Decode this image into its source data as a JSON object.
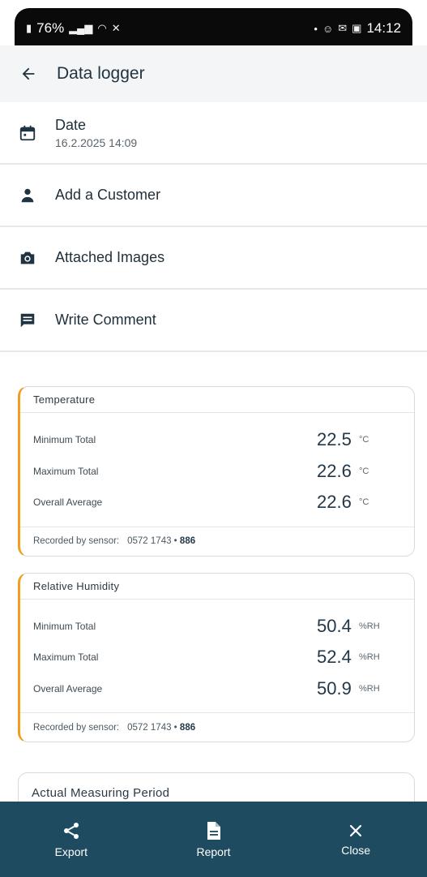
{
  "status_bar": {
    "battery": "76%",
    "time": "14:12"
  },
  "app_bar": {
    "title": "Data logger"
  },
  "menu": {
    "date_label": "Date",
    "date_value": "16.2.2025 14:09",
    "customer_label": "Add a Customer",
    "images_label": "Attached Images",
    "comment_label": "Write Comment"
  },
  "temperature": {
    "title": "Temperature",
    "rows": [
      {
        "label": "Minimum Total",
        "value": "22.5",
        "unit": "°C"
      },
      {
        "label": "Maximum Total",
        "value": "22.6",
        "unit": "°C"
      },
      {
        "label": "Overall Average",
        "value": "22.6",
        "unit": "°C"
      }
    ],
    "sensor_label": "Recorded by sensor:",
    "sensor_id": "0572 1743 •",
    "sensor_suffix": "886"
  },
  "humidity": {
    "title": "Relative Humidity",
    "rows": [
      {
        "label": "Minimum Total",
        "value": "50.4",
        "unit": "%RH"
      },
      {
        "label": "Maximum Total",
        "value": "52.4",
        "unit": "%RH"
      },
      {
        "label": "Overall Average",
        "value": "50.9",
        "unit": "%RH"
      }
    ],
    "sensor_label": "Recorded by sensor:",
    "sensor_id": "0572 1743 •",
    "sensor_suffix": "886"
  },
  "period": {
    "title": "Actual Measuring Period"
  },
  "bottom_bar": {
    "export_label": "Export",
    "report_label": "Report",
    "close_label": "Close"
  },
  "colors": {
    "accent": "#f39c1f",
    "bottom_bar": "#1e4b5f"
  }
}
